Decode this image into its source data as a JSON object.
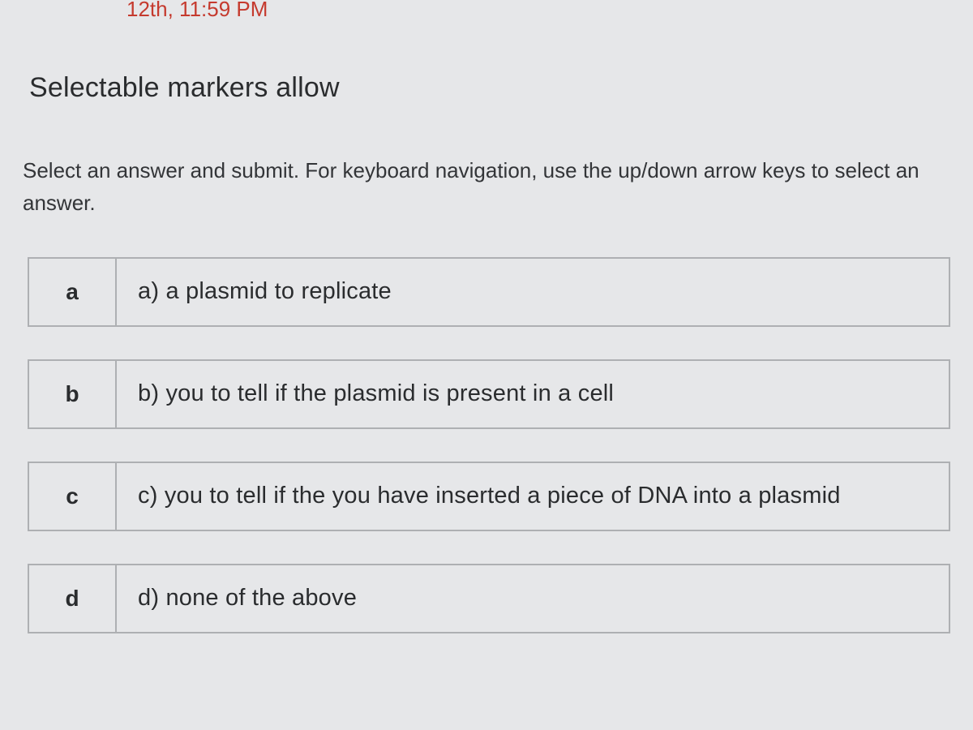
{
  "header": {
    "due_date": "12th, 11:59 PM"
  },
  "question": {
    "prompt": "Selectable markers allow",
    "instructions": "Select an answer and submit. For keyboard navigation, use the up/down arrow keys to select an answer."
  },
  "options": [
    {
      "key": "a",
      "text": "a) a plasmid to replicate"
    },
    {
      "key": "b",
      "text": "b) you to tell if the plasmid is present in a cell"
    },
    {
      "key": "c",
      "text": "c) you to tell if the you have inserted a piece of DNA into a plasmid"
    },
    {
      "key": "d",
      "text": "d) none of the above"
    }
  ]
}
